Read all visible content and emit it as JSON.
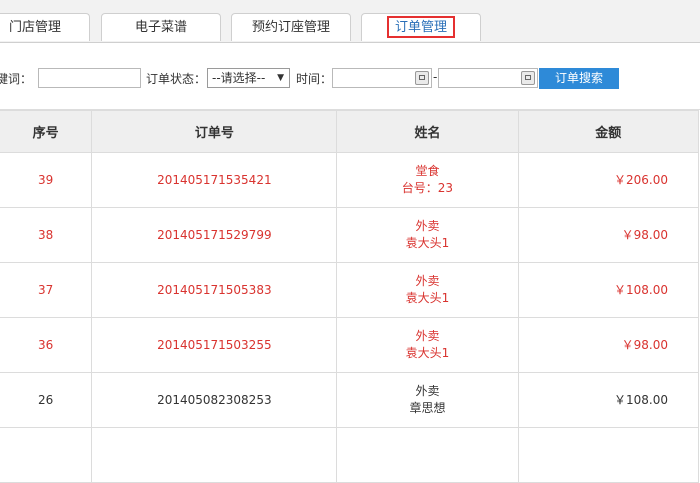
{
  "tabs": [
    {
      "label": "门店管理",
      "active": false
    },
    {
      "label": "电子菜谱",
      "active": false
    },
    {
      "label": "预约订座管理",
      "active": false
    },
    {
      "label": "订单管理",
      "active": true
    }
  ],
  "filter": {
    "keyword_label": "关键词：",
    "keyword_value": "",
    "status_label": "订单状态：",
    "status_selected": "--请选择--",
    "time_label": "时间：",
    "date_from": "",
    "date_sep": "-",
    "date_to": "",
    "search_button": "订单搜索"
  },
  "table": {
    "columns": [
      "序号",
      "订单号",
      "姓名",
      "金额"
    ],
    "rows": [
      {
        "no": "39",
        "order_no": "201405171535421",
        "type": "堂食",
        "name": "台号：23",
        "amount": "￥206.00",
        "highlight": true
      },
      {
        "no": "38",
        "order_no": "201405171529799",
        "type": "外卖",
        "name": "袁大头1",
        "amount": "￥98.00",
        "highlight": true
      },
      {
        "no": "37",
        "order_no": "201405171505383",
        "type": "外卖",
        "name": "袁大头1",
        "amount": "￥108.00",
        "highlight": true
      },
      {
        "no": "36",
        "order_no": "201405171503255",
        "type": "外卖",
        "name": "袁大头1",
        "amount": "￥98.00",
        "highlight": true
      },
      {
        "no": "26",
        "order_no": "201405082308253",
        "type": "外卖",
        "name": "章思想",
        "amount": "￥108.00",
        "highlight": false
      }
    ]
  },
  "colors": {
    "highlight_text": "#d9332f",
    "accent_button": "#2e8ad8",
    "active_tab_border": "#e53030"
  }
}
